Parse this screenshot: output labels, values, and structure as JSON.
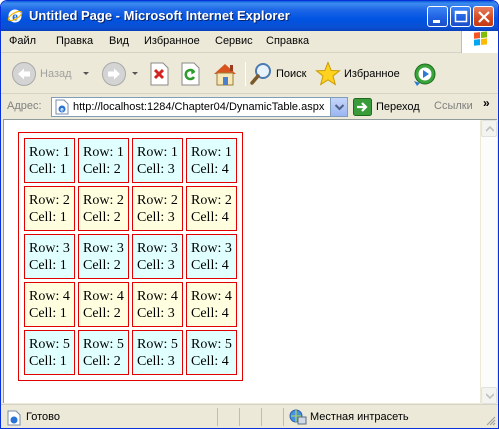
{
  "window": {
    "title": "Untitled Page - Microsoft Internet Explorer"
  },
  "menu": {
    "items": [
      {
        "label": "Файл"
      },
      {
        "label": "Правка"
      },
      {
        "label": "Вид"
      },
      {
        "label": "Избранное"
      },
      {
        "label": "Сервис"
      },
      {
        "label": "Справка"
      }
    ]
  },
  "toolbar": {
    "back_label": "Назад",
    "search_label": "Поиск",
    "favorites_label": "Избранное"
  },
  "address": {
    "label": "Адрес:",
    "url": "http://localhost:1284/Chapter04/DynamicTable.aspx",
    "go_label": "Переход",
    "links_label": "Ссылки",
    "more_label": "»"
  },
  "table": {
    "rows": [
      {
        "cells": [
          {
            "line1": "Row: 1",
            "line2": "Cell: 1"
          },
          {
            "line1": "Row: 1",
            "line2": "Cell: 2"
          },
          {
            "line1": "Row: 1",
            "line2": "Cell: 3"
          },
          {
            "line1": "Row: 1",
            "line2": "Cell: 4"
          }
        ]
      },
      {
        "cells": [
          {
            "line1": "Row: 2",
            "line2": "Cell: 1"
          },
          {
            "line1": "Row: 2",
            "line2": "Cell: 2"
          },
          {
            "line1": "Row: 2",
            "line2": "Cell: 3"
          },
          {
            "line1": "Row: 2",
            "line2": "Cell: 4"
          }
        ]
      },
      {
        "cells": [
          {
            "line1": "Row: 3",
            "line2": "Cell: 1"
          },
          {
            "line1": "Row: 3",
            "line2": "Cell: 2"
          },
          {
            "line1": "Row: 3",
            "line2": "Cell: 3"
          },
          {
            "line1": "Row: 3",
            "line2": "Cell: 4"
          }
        ]
      },
      {
        "cells": [
          {
            "line1": "Row: 4",
            "line2": "Cell: 1"
          },
          {
            "line1": "Row: 4",
            "line2": "Cell: 2"
          },
          {
            "line1": "Row: 4",
            "line2": "Cell: 3"
          },
          {
            "line1": "Row: 4",
            "line2": "Cell: 4"
          }
        ]
      },
      {
        "cells": [
          {
            "line1": "Row: 5",
            "line2": "Cell: 1"
          },
          {
            "line1": "Row: 5",
            "line2": "Cell: 2"
          },
          {
            "line1": "Row: 5",
            "line2": "Cell: 3"
          },
          {
            "line1": "Row: 5",
            "line2": "Cell: 4"
          }
        ]
      }
    ],
    "colors": {
      "border": "#e00000",
      "odd_row_bg": "#e0ffff",
      "even_row_bg": "#ffffe0"
    }
  },
  "status": {
    "text": "Готово",
    "zone": "Местная интрасеть"
  },
  "icons": {
    "app": "ie-icon",
    "back": "back-arrow-icon",
    "forward": "forward-arrow-icon",
    "stop": "stop-icon",
    "refresh": "refresh-icon",
    "home": "home-icon",
    "search": "search-icon",
    "favorites": "favorites-star-icon",
    "media": "media-icon",
    "page": "page-icon",
    "go": "go-arrow-icon",
    "zone": "intranet-zone-icon"
  }
}
